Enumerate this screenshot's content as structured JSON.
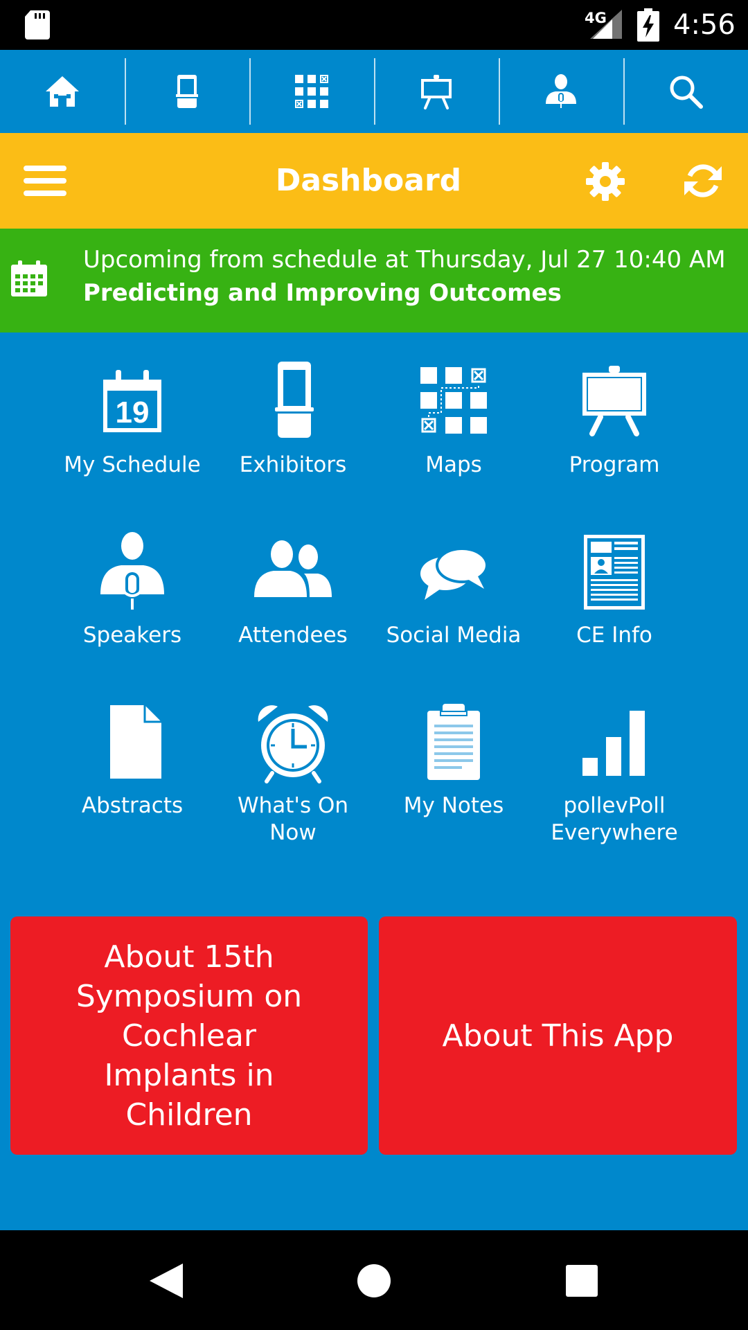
{
  "status_bar": {
    "network": "4G",
    "time": "4:56"
  },
  "top_nav": {
    "items": [
      {
        "icon": "home-icon"
      },
      {
        "icon": "exhibitor-booth-icon"
      },
      {
        "icon": "map-grid-icon"
      },
      {
        "icon": "presentation-easel-icon"
      },
      {
        "icon": "speaker-icon"
      },
      {
        "icon": "search-icon"
      }
    ]
  },
  "header": {
    "title": "Dashboard"
  },
  "upcoming": {
    "line1": "Upcoming from schedule at Thursday, Jul 27 10:40 AM",
    "line2": "Predicting and Improving Outcomes"
  },
  "tiles": [
    {
      "label": "My Schedule",
      "icon": "calendar-icon"
    },
    {
      "label": "Exhibitors",
      "icon": "exhibitor-booth-icon"
    },
    {
      "label": "Maps",
      "icon": "map-grid-icon"
    },
    {
      "label": "Program",
      "icon": "presentation-easel-icon"
    },
    {
      "label": "Speakers",
      "icon": "speaker-icon"
    },
    {
      "label": "Attendees",
      "icon": "people-icon"
    },
    {
      "label": "Social Media",
      "icon": "chat-bubbles-icon"
    },
    {
      "label": "CE Info",
      "icon": "newspaper-icon"
    },
    {
      "label": "Abstracts",
      "icon": "document-icon"
    },
    {
      "label_line1": "What's On",
      "label_line2": "Now",
      "icon": "alarm-clock-icon"
    },
    {
      "label": "My Notes",
      "icon": "clipboard-icon"
    },
    {
      "label_line1": "pollevPoll",
      "label_line2": "Everywhere",
      "icon": "bar-chart-icon"
    }
  ],
  "calendar_day": "19",
  "buttons": {
    "about_symposium": [
      "About 15th",
      "Symposium on",
      "Cochlear",
      "Implants in",
      "Children"
    ],
    "about_app": "About This App"
  },
  "colors": {
    "primary_blue": "#0088cc",
    "header_yellow": "#fbbd16",
    "upcoming_green": "#37b213",
    "button_red": "#ed1c24"
  }
}
